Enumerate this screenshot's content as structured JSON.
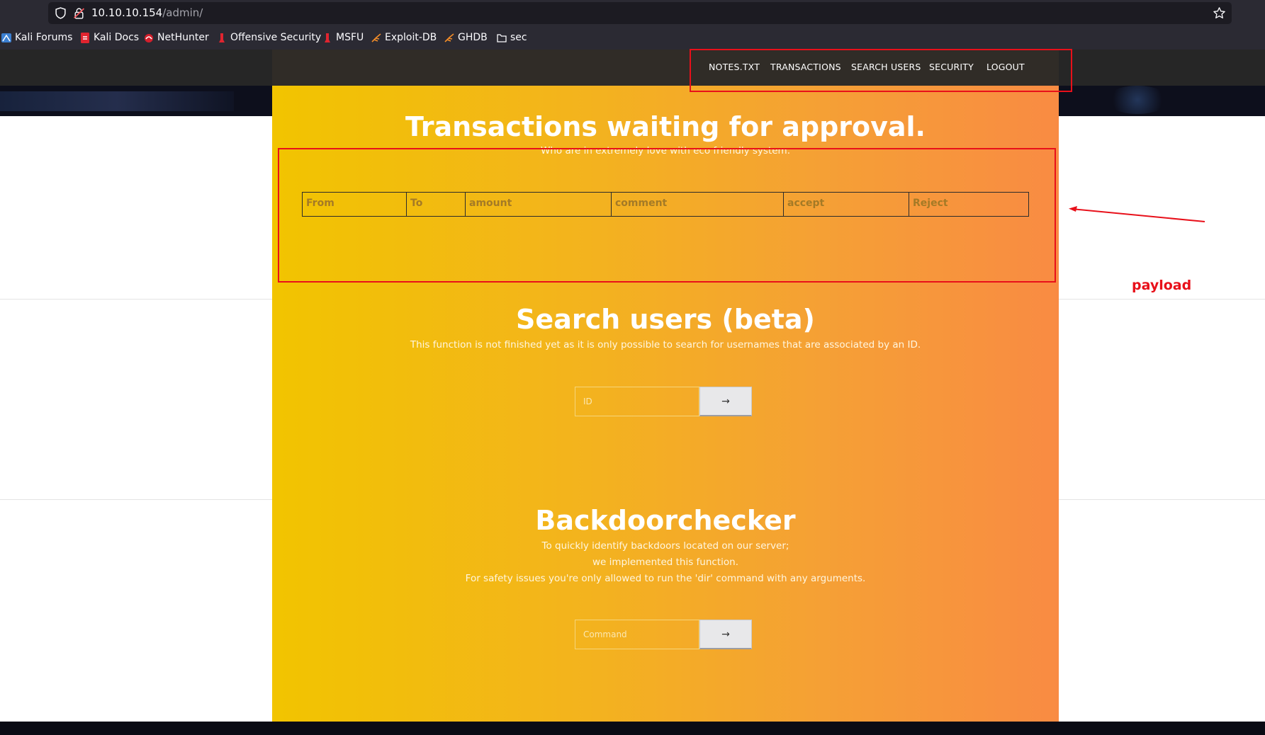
{
  "browser": {
    "url_host": "10.10.10.154",
    "url_path": "/admin/",
    "bookmarks": [
      {
        "label": "Kali Forums",
        "icon": "kali-dragon-icon"
      },
      {
        "label": "Kali Docs",
        "icon": "kali-docs-icon"
      },
      {
        "label": "NetHunter",
        "icon": "nethunter-icon"
      },
      {
        "label": "Offensive Security",
        "icon": "offsec-icon"
      },
      {
        "label": "MSFU",
        "icon": "offsec-icon"
      },
      {
        "label": "Exploit-DB",
        "icon": "exploitdb-icon"
      },
      {
        "label": "GHDB",
        "icon": "exploitdb-icon"
      },
      {
        "label": "sec",
        "icon": "folder-icon"
      }
    ]
  },
  "nav": {
    "items": [
      "NOTES.TXT",
      "TRANSACTIONS",
      "SEARCH USERS",
      "SECURITY",
      "LOGOUT"
    ]
  },
  "transactions": {
    "title": "Transactions waiting for approval.",
    "subtitle": "Who are in extremely love with eco friendly system.",
    "columns": [
      "From",
      "To",
      "amount",
      "comment",
      "accept",
      "Reject"
    ]
  },
  "search": {
    "title": "Search users (beta)",
    "subtitle": "This function is not finished yet as it is only possible to search for usernames that are associated by an ID.",
    "placeholder": "ID",
    "button": "→"
  },
  "backdoor": {
    "title": "Backdoorchecker",
    "lines": [
      "To quickly identify backdoors located on our server;",
      "we implemented this function.",
      "For safety issues you're only allowed to run the 'dir' command with any arguments."
    ],
    "placeholder": "Command",
    "button": "→"
  },
  "annotation": {
    "label": "payload",
    "color": "#e8101a"
  },
  "colors": {
    "gradient_start": "#f2c400",
    "gradient_end": "#f98b43",
    "nav_bg": "#262626"
  }
}
